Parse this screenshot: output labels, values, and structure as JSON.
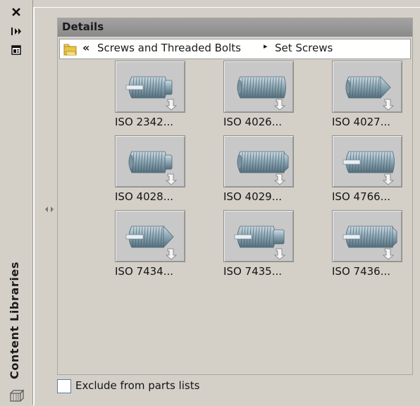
{
  "palette": {
    "title": "Content Libraries"
  },
  "details": {
    "header": "Details"
  },
  "breadcrumb": {
    "back": "«",
    "items": [
      "Screws and Threaded Bolts",
      "Set Screws"
    ],
    "separator": "▸"
  },
  "parts": [
    {
      "label": "ISO 2342...",
      "icon": "slotted-set-screw-dog-point-icon"
    },
    {
      "label": "ISO 4026...",
      "icon": "socket-set-screw-flat-point-icon"
    },
    {
      "label": "ISO 4027...",
      "icon": "socket-set-screw-cone-point-icon"
    },
    {
      "label": "ISO 4028...",
      "icon": "socket-set-screw-dog-point-icon"
    },
    {
      "label": "ISO 4029...",
      "icon": "socket-set-screw-cup-point-icon"
    },
    {
      "label": "ISO 4766...",
      "icon": "slotted-set-screw-flat-point-icon"
    },
    {
      "label": "ISO 7434...",
      "icon": "slotted-set-screw-cone-point-icon"
    },
    {
      "label": "ISO 7435...",
      "icon": "slotted-set-screw-long-dog-point-icon"
    },
    {
      "label": "ISO 7436...",
      "icon": "slotted-set-screw-cup-point-icon"
    }
  ],
  "options": {
    "exclude_label": "Exclude from parts lists",
    "exclude_checked": false
  },
  "colors": {
    "header_bg": "#8f8f8f",
    "panel_bg": "#d4d0c8",
    "screw_metal": "#8fa9b7"
  }
}
